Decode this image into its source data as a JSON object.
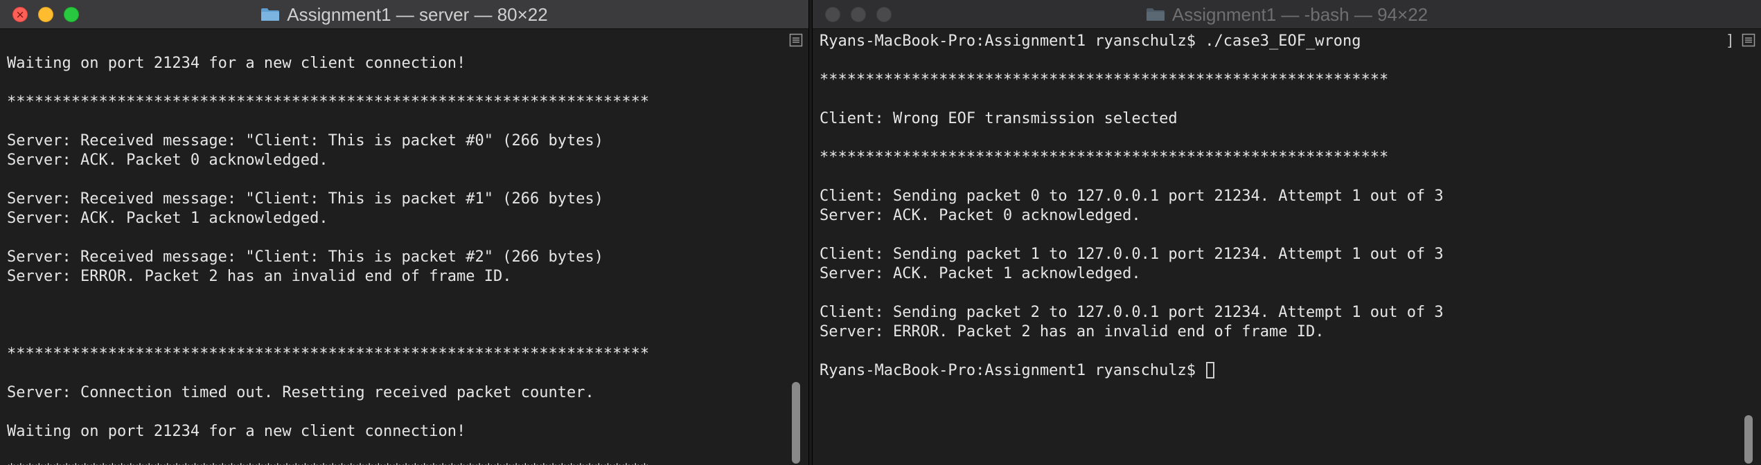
{
  "left_window": {
    "title": "Assignment1 — server — 80×22",
    "lines": [
      "",
      "Waiting on port 21234 for a new client connection!",
      "",
      "**********************************************************************",
      "",
      "Server: Received message: \"Client: This is packet #0\" (266 bytes)",
      "Server: ACK. Packet 0 acknowledged.",
      "",
      "Server: Received message: \"Client: This is packet #1\" (266 bytes)",
      "Server: ACK. Packet 1 acknowledged.",
      "",
      "Server: Received message: \"Client: This is packet #2\" (266 bytes)",
      "Server: ERROR. Packet 2 has an invalid end of frame ID.",
      "",
      "",
      "",
      "**********************************************************************",
      "",
      "Server: Connection timed out. Resetting received packet counter.",
      "",
      "Waiting on port 21234 for a new client connection!",
      "",
      "**********************************************************************"
    ]
  },
  "right_window": {
    "title": "Assignment1 — -bash — 94×22",
    "prompt_end": "]",
    "lines": [
      "Ryans-MacBook-Pro:Assignment1 ryanschulz$ ./case3_EOF_wrong",
      "",
      "**************************************************************",
      "",
      "Client: Wrong EOF transmission selected",
      "",
      "**************************************************************",
      "",
      "Client: Sending packet 0 to 127.0.0.1 port 21234. Attempt 1 out of 3",
      "Server: ACK. Packet 0 acknowledged.",
      "",
      "Client: Sending packet 1 to 127.0.0.1 port 21234. Attempt 1 out of 3",
      "Server: ACK. Packet 1 acknowledged.",
      "",
      "Client: Sending packet 2 to 127.0.0.1 port 21234. Attempt 1 out of 3",
      "Server: ERROR. Packet 2 has an invalid end of frame ID.",
      "",
      "Ryans-MacBook-Pro:Assignment1 ryanschulz$ "
    ]
  },
  "icons": {
    "close": "close-icon",
    "minimize": "minimize-icon",
    "maximize": "maximize-icon",
    "folder": "folder-icon",
    "split_pane": "split-pane-icon"
  },
  "colors": {
    "close": "#fe5f57",
    "minimize": "#febc2e",
    "maximize": "#28c840",
    "terminal_bg": "#1e1e1e",
    "terminal_text": "#e6e6e6",
    "folder_active": "#5f9ed1",
    "folder_inactive": "#4d5b66"
  }
}
